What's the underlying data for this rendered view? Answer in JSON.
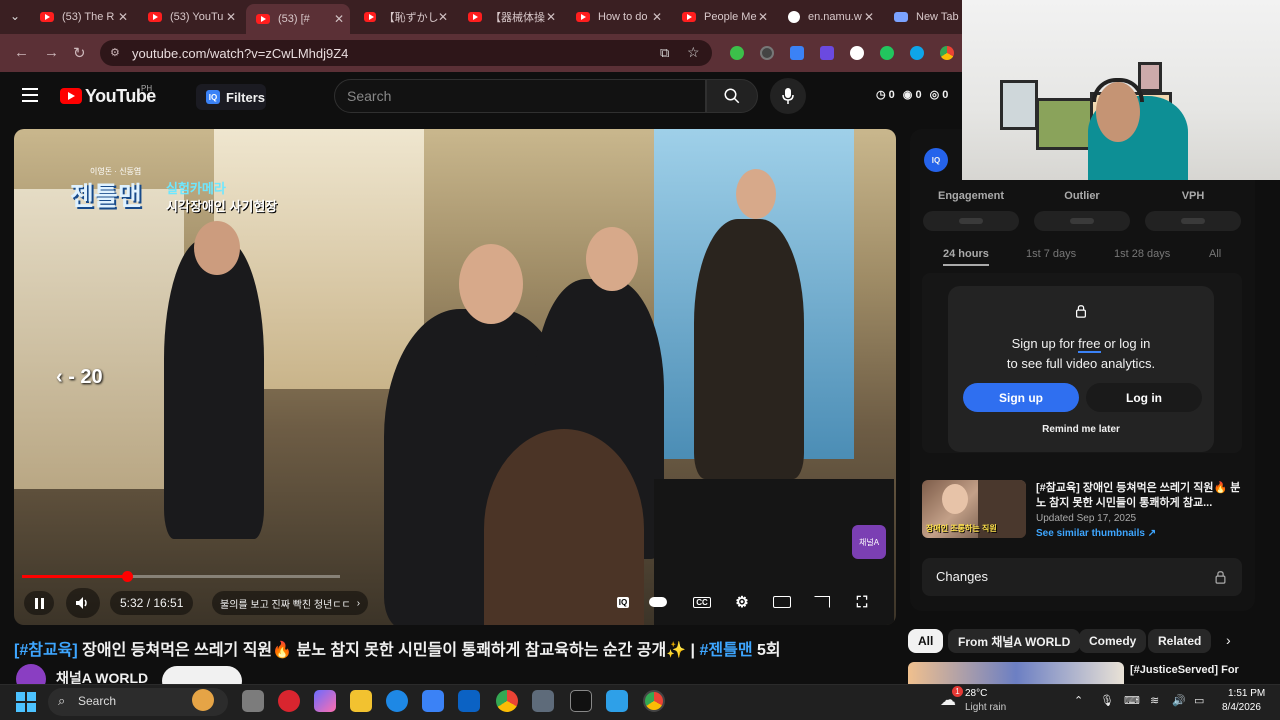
{
  "browser": {
    "tabs": [
      {
        "label": "(53) The R",
        "icon": "youtube-icon"
      },
      {
        "label": "(53) YouTu",
        "icon": "youtube-icon"
      },
      {
        "label": "(53) [#",
        "icon": "youtube-icon",
        "active": true
      },
      {
        "label": "【恥ずかしす",
        "icon": "youtube-icon"
      },
      {
        "label": "【器械体操",
        "icon": "youtube-icon"
      },
      {
        "label": "How to do",
        "icon": "youtube-icon"
      },
      {
        "label": "People Me",
        "icon": "youtube-icon"
      },
      {
        "label": "en.namu.w",
        "icon": "google-icon"
      },
      {
        "label": "New Tab",
        "icon": "new-tab-icon"
      }
    ],
    "url": "youtube.com/watch?v=zCwLMhdj9Z4"
  },
  "youtube": {
    "logo_text": "YouTube",
    "country": "PH",
    "filters_label": "Filters",
    "search_placeholder": "Search",
    "counters": [
      "0",
      "0",
      "0"
    ]
  },
  "video": {
    "show_top": "이영돈 · 신동엽",
    "show_logo": "젠틀맨",
    "show_sub1": "실험카메라",
    "show_sub2": "시각장애인 사기현장",
    "seek_back": "- 20",
    "channel_badge": "채널A",
    "progress_fraction": 0.33,
    "time": "5:32 / 16:51",
    "chapter": "불의를 보고 진짜 빡친 청년ㄷㄷ",
    "title_tag1": "[#참교육]",
    "title_main": " 장애인 등쳐먹은 쓰레기 직원🔥 분노 참지 못한 시민들이 통쾌하게 참교육하는 순간 공개✨ | ",
    "title_tag2": "#젠틀맨",
    "title_ep": " 5회",
    "channel_name": "채널A WORLD"
  },
  "panel": {
    "metric_headers": [
      "Engagement",
      "Outlier",
      "VPH"
    ],
    "time_tabs": [
      "24 hours",
      "1st 7 days",
      "1st 28 days",
      "All"
    ],
    "modal_line1_a": "Sign up for ",
    "modal_line1_b": "free",
    "modal_line1_c": " or log in",
    "modal_line2": "to see full video analytics.",
    "signup": "Sign up",
    "login": "Log in",
    "remind": "Remind me later",
    "thumb_overlay": "장애인 조롱하는 직원",
    "thumb_title": "[#참교육] 장애인 등쳐먹은 쓰레기 직원🔥 분노 참지 못한 시민들이 통쾌하게 참교...",
    "thumb_updated": "Updated Sep 17, 2025",
    "thumb_link": "See similar thumbnails ↗",
    "changes": "Changes"
  },
  "chips": [
    "All",
    "From 채널A WORLD",
    "Comedy",
    "Related"
  ],
  "next_video_title": "[#JusticeServed] For",
  "taskbar": {
    "search": "Search",
    "temp": "28°C",
    "weather": "Light rain",
    "time": "1:51 PM",
    "date": "8/4/2026",
    "weather_badge": "1"
  }
}
